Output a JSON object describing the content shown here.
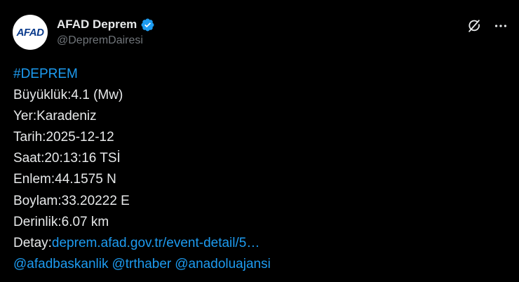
{
  "author": {
    "avatar_text": "AFAD",
    "display_name": "AFAD Deprem",
    "handle": "@DepremDairesi"
  },
  "colors": {
    "background": "#000000",
    "text": "#e7e9ea",
    "muted": "#71767b",
    "link": "#1d9bf0",
    "avatar_text": "#0b3b8c"
  },
  "icons": {
    "verified": "verified-badge-icon",
    "grok": "grok-icon",
    "more": "more-options-icon"
  },
  "tweet": {
    "hashtag": "#DEPREM",
    "lines": [
      "Büyüklük:4.1 (Mw)",
      "Yer:Karadeniz",
      "Tarih:2025-12-12",
      "Saat:20:13:16 TSİ",
      "Enlem:44.1575 N",
      "Boylam:33.20222 E",
      "Derinlik:6.07 km"
    ],
    "detail_label": "Detay:",
    "detail_link": "deprem.afad.gov.tr/event-detail/5…",
    "mentions": [
      "@afadbaskanlik",
      "@trthaber",
      "@anadoluajansi"
    ]
  }
}
